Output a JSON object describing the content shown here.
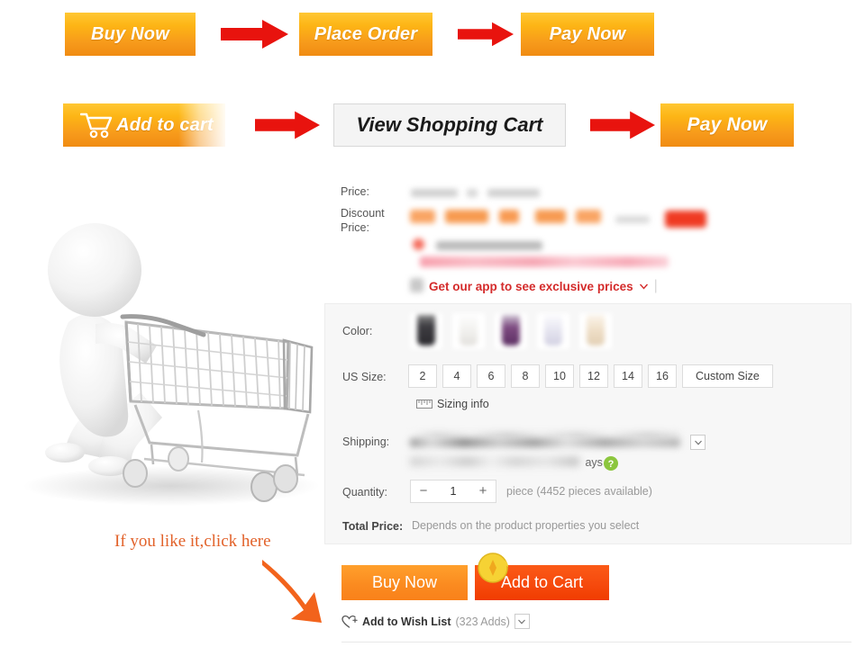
{
  "flow_steps_row1": [
    {
      "label": "Buy Now",
      "style": "orange"
    },
    {
      "label": "Place Order",
      "style": "orange"
    },
    {
      "label": "Pay Now",
      "style": "orange"
    }
  ],
  "flow_steps_row2": [
    {
      "label": "Add to cart",
      "style": "orange",
      "icon": "shopping-cart-icon"
    },
    {
      "label": "View Shopping Cart",
      "style": "white"
    },
    {
      "label": "Pay Now",
      "style": "orange"
    }
  ],
  "arrow_icon_name": "right-arrow-icon",
  "illustration": {
    "name": "3d-person-pushing-shopping-cart",
    "hint_text": "If you like it,click here",
    "hint_arrow_icon": "curved-down-right-arrow-icon"
  },
  "product": {
    "price_label": "Price:",
    "discount_price_label": "Discount Price:",
    "app_promo_text": "Get our app to see exclusive prices",
    "app_promo_color": "#d42b2b",
    "color_label": "Color:",
    "color_swatches": [
      {
        "name": "swatch-charcoal",
        "color": "#3e3d42"
      },
      {
        "name": "swatch-white",
        "color": "#f0eeeb"
      },
      {
        "name": "swatch-purple",
        "color": "#6b3a6e"
      },
      {
        "name": "swatch-lavender",
        "color": "#dcdbe8"
      },
      {
        "name": "swatch-champagne",
        "color": "#e9d8c2"
      }
    ],
    "us_size_label": "US Size:",
    "us_sizes": [
      "2",
      "4",
      "6",
      "8",
      "10",
      "12",
      "14",
      "16"
    ],
    "custom_size_label": "Custom Size",
    "sizing_info_label": "Sizing info",
    "sizing_info_icon": "ruler-icon",
    "shipping_label": "Shipping:",
    "shipping_days_suffix": "ays",
    "shipping_help_icon": "question-mark-icon",
    "shipping_help_color": "#8cc63e",
    "quantity_label": "Quantity:",
    "quantity_value": "1",
    "quantity_decrement": "−",
    "quantity_increment": "+",
    "quantity_unit_text": "piece (4452 pieces available)",
    "total_price_label": "Total Price:",
    "total_price_value": "Depends on the product properties you select"
  },
  "actions": {
    "buy_now_label": "Buy Now",
    "add_to_cart_label": "Add to Cart",
    "coin_badge_icon": "coin-bonus-icon",
    "wish_list_label": "Add to Wish List",
    "wish_list_count": "(323 Adds)",
    "wish_list_icon": "heart-plus-icon",
    "wish_list_chevron_icon": "chevron-down-icon"
  },
  "colors": {
    "orange_cta": "#f9a41c",
    "red_arrow": "#e8130e",
    "panel_bg": "#f7f7f7",
    "add_to_cart_red": "#f64a0d",
    "hint_orange": "#e2622a"
  }
}
